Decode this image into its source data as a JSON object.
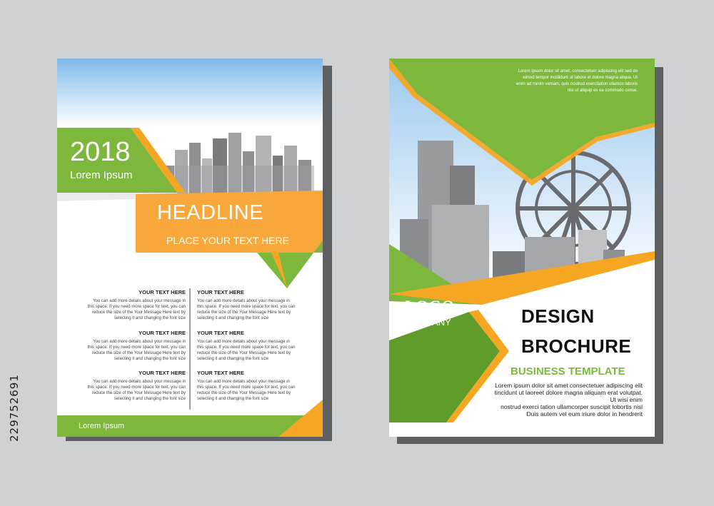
{
  "stock_id": "229752691",
  "colors": {
    "green": "#7db83c",
    "orange": "#f5a623",
    "sky": "#9cc9ee",
    "shadow": "#5e5f61",
    "building": "#8e8f92"
  },
  "left_page": {
    "year": "2018",
    "subtitle": "Lorem  Ipsum",
    "headline": "HEADLINE",
    "subheadline": "PLACE YOUR TEXT HERE",
    "columns": [
      {
        "title": "YOUR TEXT HERE",
        "lines": [
          "You can add more details about your message in",
          "this space. If you need more space for text, you can",
          "reduce the size of the Your Message Here text by",
          "selecting it and changing the font size"
        ]
      },
      {
        "title": "YOUR TEXT HERE",
        "lines": [
          "You can add more details about your message in",
          "this space. If you need more space for text, you can",
          "reduce the size of the Your Message Here text by",
          "selecting it and changing the font size"
        ]
      },
      {
        "title": "YOUR TEXT HERE",
        "lines": [
          "You can add more details about your message in",
          "this space. If you need more space for text, you can",
          "reduce the size of the Your Message Here text by",
          "selecting it and changing the font size"
        ]
      },
      {
        "title": "YOUR TEXT HERE",
        "lines": [
          "You can add more details about your message in",
          "this space. If you need more space for text, you can",
          "reduce the size of the Your Message Here text by",
          "selecting it and changing the font size"
        ]
      },
      {
        "title": "YOUR TEXT HERE",
        "lines": [
          "You can add more details about your message in",
          "this space. If you need more space for text, you can",
          "reduce the size of the Your Message Here text by",
          "selecting it and changing the font size"
        ]
      },
      {
        "title": "YOUR TEXT HERE",
        "lines": [
          "You can add more details about your message in",
          "this space. If you need more space for text, you can",
          "reduce the size of the Your Message Here text by",
          "selecting it and changing the font size"
        ]
      }
    ],
    "footer": "Lorem  Ipsum"
  },
  "right_page": {
    "top_text": [
      "Lorem ipsum dolor sit amet, consectetuer adipiscing elit sed do",
      "eimod tempor incididunt ut labore et dolore magna aliqua. Ut",
      "enim ad minim veniam, quis nostrud exercitation ullamco laboris",
      "nisi ut aliquip ex ea commodo conse."
    ],
    "logo": "LOGO",
    "company": "COMPANY",
    "title_line1": "DESIGN",
    "title_line2": "BROCHURE",
    "tagline": "BUSINESS TEMPLATE",
    "body": [
      "Lorem ipsum dolor sit amet  consectetuer adipiscing elit",
      "tincidunt ut laoreet dolore magna aliquam erat volutpat. Ut wisi enim",
      "nostrud exerci tation ullamcorper suscipit lobortis nisl",
      "Duis autem vel eum iriure dolor in hendrerit"
    ]
  }
}
